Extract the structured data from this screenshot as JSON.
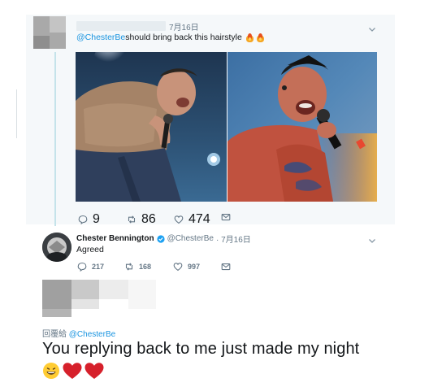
{
  "tweet1": {
    "date": "7月16日",
    "mention": "@ChesterBe",
    "text": " should bring back this hairstyle",
    "emojis": [
      "fire",
      "fire"
    ],
    "actions": {
      "reply_count": "9",
      "retweet_count": "86",
      "like_count": "474"
    }
  },
  "tweet2": {
    "name": "Chester Bennington",
    "handle": "@ChesterBe",
    "date": "· 7月16日",
    "text": "Agreed",
    "actions": {
      "reply_count": "217",
      "retweet_count": "168",
      "like_count": "997"
    }
  },
  "tweet3": {
    "reply_prefix": "回覆給",
    "reply_mention": "@ChesterBe",
    "text": "You replying back to me just made my night",
    "emojis": [
      "grinning-face",
      "red-heart",
      "red-heart"
    ]
  },
  "colors": {
    "link": "#1b95e0",
    "muted": "#657786",
    "highlight_bg": "#f5f8fa",
    "thread_line": "#c5e3ea"
  }
}
